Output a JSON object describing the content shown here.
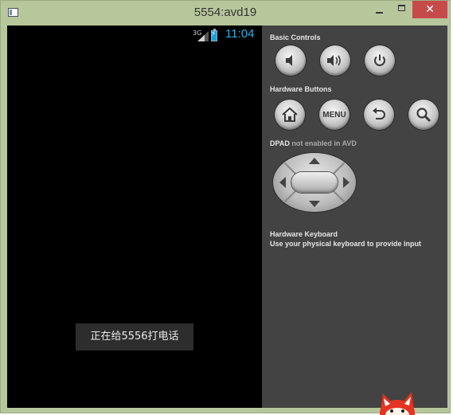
{
  "window": {
    "title": "5554:avd19",
    "close_glyph": "✕"
  },
  "phone": {
    "network_label": "3G",
    "clock": "11:04",
    "toast": "正在给5556打电话"
  },
  "panel": {
    "basic_controls_label": "Basic Controls",
    "basic_controls": [
      "volume-down-icon",
      "volume-up-icon",
      "power-icon"
    ],
    "hardware_buttons_label": "Hardware Buttons",
    "hardware_buttons": [
      "home-icon",
      "MENU",
      "back-icon",
      "search-icon"
    ],
    "menu_label": "MENU",
    "dpad_label": "DPAD",
    "dpad_status": "not enabled in AVD",
    "keyboard_title": "Hardware Keyboard",
    "keyboard_hint": "Use your physical keyboard to provide input"
  },
  "colors": {
    "frame": "#b7c79c",
    "panel": "#434343",
    "screen": "#000000",
    "clock": "#2fb0e6",
    "close": "#c74a4a"
  }
}
